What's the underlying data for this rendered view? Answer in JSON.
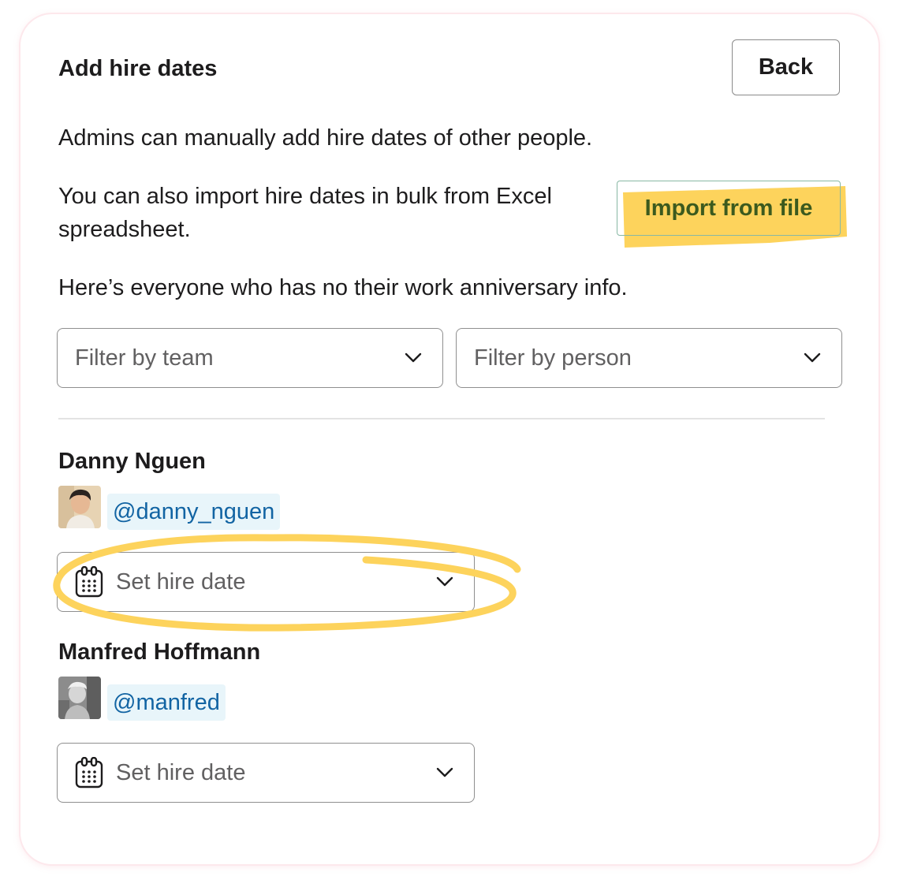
{
  "header": {
    "title": "Add hire dates",
    "back_label": "Back"
  },
  "intro": {
    "line1": "Admins can manually add hire dates of other people.",
    "line2": "You can also import hire dates in bulk from Excel spreadsheet.",
    "import_label": "Import from file",
    "line3": "Here’s everyone who has no their work anniversary info."
  },
  "filters": {
    "team_placeholder": "Filter by team",
    "person_placeholder": "Filter by person"
  },
  "people": [
    {
      "name": "Danny Nguen",
      "handle": "@danny_nguen",
      "date_placeholder": "Set hire date"
    },
    {
      "name": "Manfred Hoffmann",
      "handle": "@manfred",
      "date_placeholder": "Set hire date"
    }
  ],
  "colors": {
    "highlight": "#fdd35c",
    "link": "#1264a3",
    "handle_bg": "#e8f5fa",
    "import_text": "#3c5a1e"
  }
}
